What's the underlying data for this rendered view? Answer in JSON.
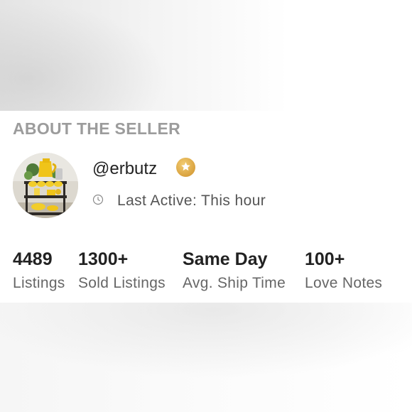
{
  "section": {
    "title": "ABOUT THE SELLER"
  },
  "seller": {
    "username": "@erbutz",
    "badge_icon": "star-badge",
    "badge_color": "#D9A23F",
    "last_active": "Last Active: This hour"
  },
  "stats": [
    {
      "value": "4489",
      "label": "Listings"
    },
    {
      "value": "1300+",
      "label": "Sold Listings"
    },
    {
      "value": "Same Day",
      "label": "Avg. Ship Time"
    },
    {
      "value": "100+",
      "label": "Love Notes"
    }
  ]
}
